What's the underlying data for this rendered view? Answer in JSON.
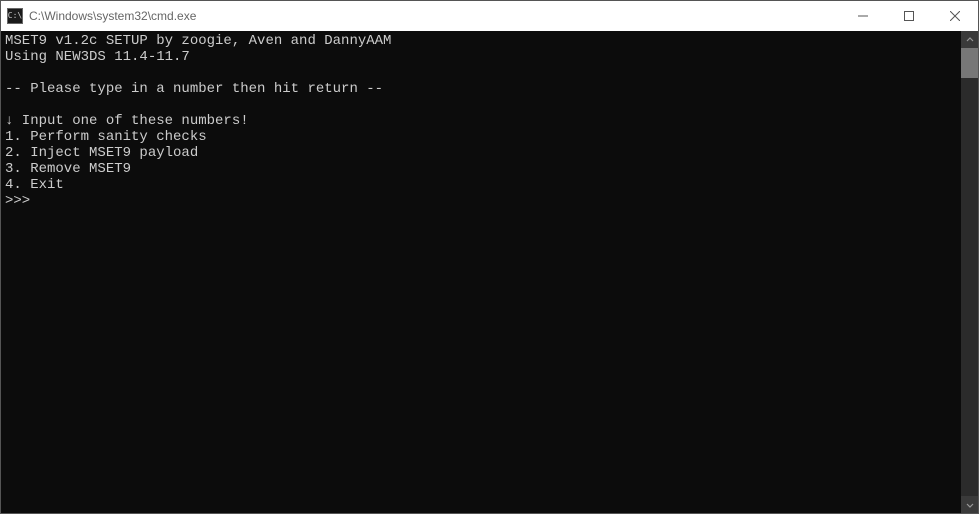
{
  "titlebar": {
    "icon_label": "C:\\",
    "title": "C:\\Windows\\system32\\cmd.exe"
  },
  "terminal": {
    "line0": "MSET9 v1.2c SETUP by zoogie, Aven and DannyAAM",
    "line1": "Using NEW3DS 11.4-11.7",
    "line2": "",
    "line3": "-- Please type in a number then hit return --",
    "line4": "",
    "line5": "↓ Input one of these numbers!",
    "line6": "1. Perform sanity checks",
    "line7": "2. Inject MSET9 payload",
    "line8": "3. Remove MSET9",
    "line9": "4. Exit",
    "prompt": ">>>"
  }
}
